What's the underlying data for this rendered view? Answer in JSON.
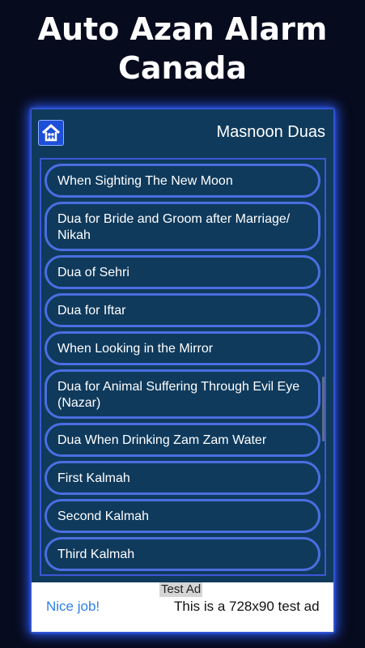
{
  "promo": {
    "line1": "Auto Azan Alarm",
    "line2": "Canada"
  },
  "appbar": {
    "home_icon": "home-icon",
    "title": "Masnoon Duas"
  },
  "duas": [
    {
      "label": "When Sighting The New Moon"
    },
    {
      "label": "Dua for Bride and Groom after Marriage/ Nikah"
    },
    {
      "label": "Dua of Sehri"
    },
    {
      "label": "Dua for Iftar"
    },
    {
      "label": "When Looking in the Mirror"
    },
    {
      "label": "Dua for Animal Suffering Through Evil Eye (Nazar)"
    },
    {
      "label": "Dua When Drinking Zam Zam Water"
    },
    {
      "label": "First Kalmah"
    },
    {
      "label": "Second Kalmah"
    },
    {
      "label": "Third Kalmah"
    }
  ],
  "ad": {
    "label": "Test Ad",
    "headline": "Nice job!",
    "text": "This is a 728x90 test ad"
  },
  "colors": {
    "background": "#070b1e",
    "panel": "#0f3a5c",
    "item_border": "#4a6ee0",
    "glow": "#2d5cff",
    "ad_link": "#2f80e8"
  }
}
